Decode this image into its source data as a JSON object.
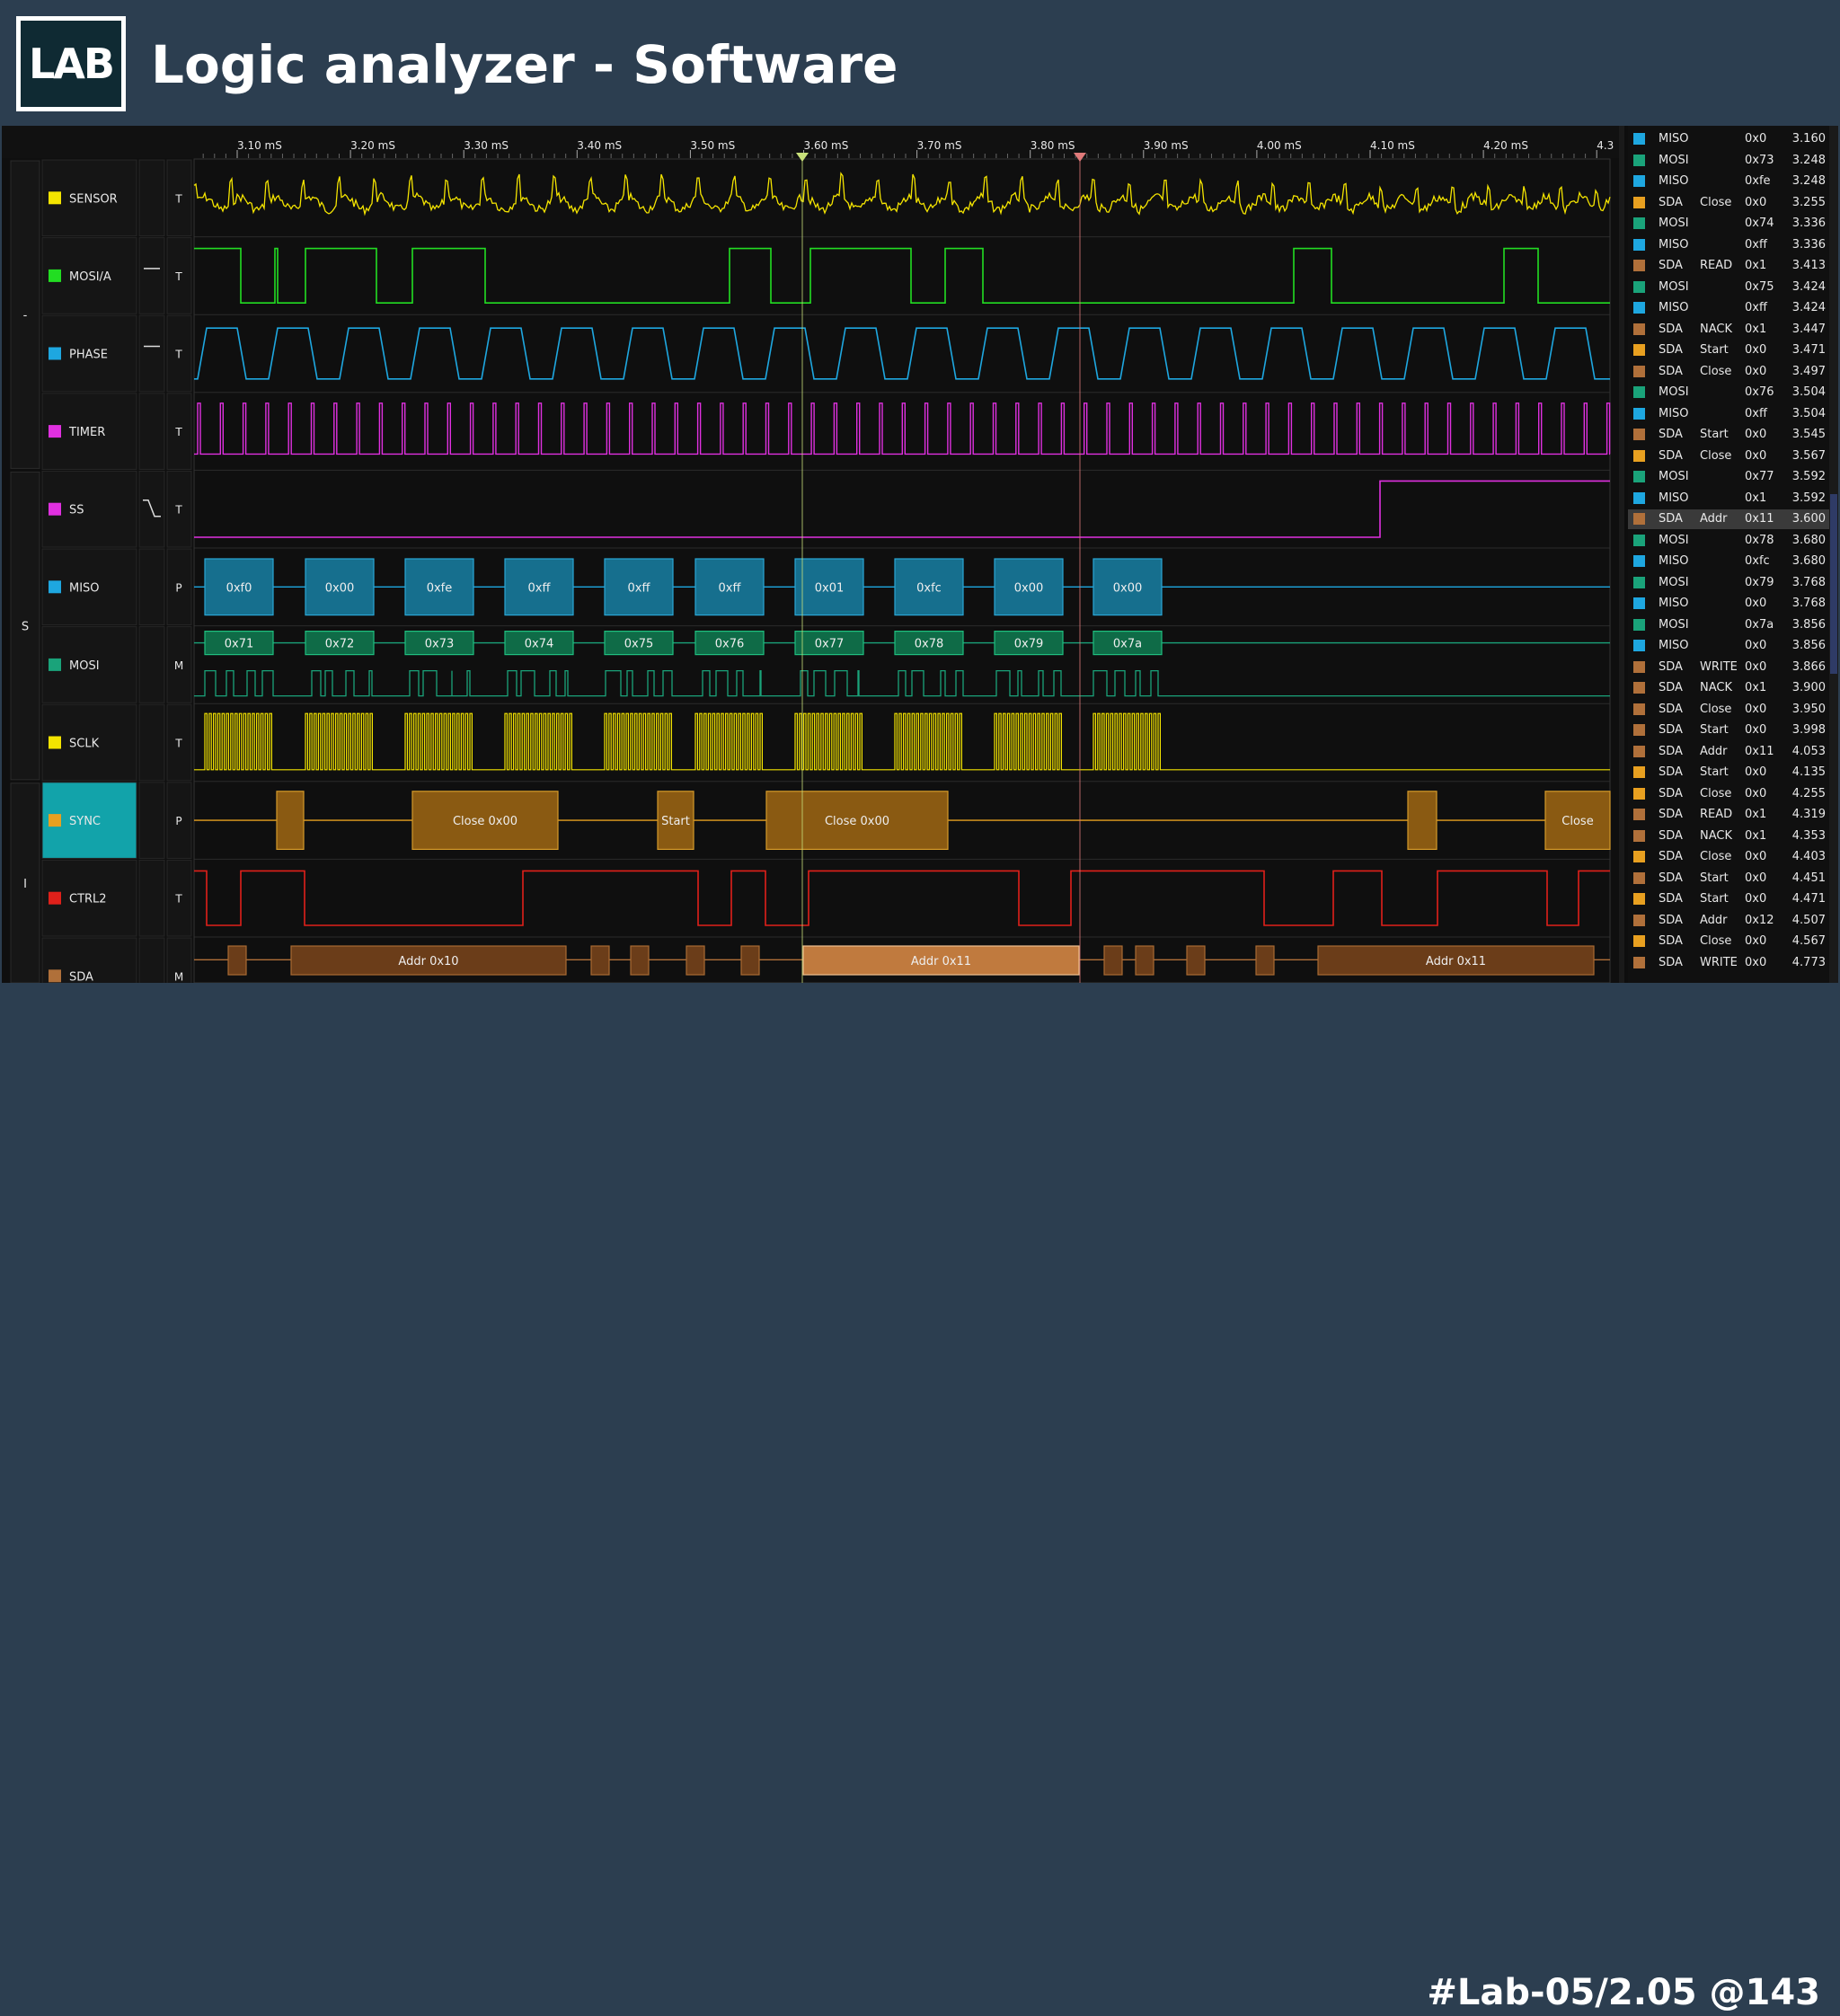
{
  "header": {
    "logo_text": "LAB",
    "title": "Logic analyzer - Software"
  },
  "footer": {
    "tag": "#Lab-05/2.05 @143"
  },
  "colors": {
    "yellow": "#f4e400",
    "green": "#22dd22",
    "cyan": "#1ea7e0",
    "magenta": "#e030e0",
    "teal": "#1aa37a",
    "orange": "#e8a020",
    "red": "#e0201a",
    "brown": "#b0703a"
  },
  "time_axis": {
    "labels": [
      "3.10 mS",
      "3.20 mS",
      "3.30 mS",
      "3.40 mS",
      "3.50 mS",
      "3.60 mS",
      "3.70 mS",
      "3.80 mS",
      "3.90 mS",
      "4.00 mS",
      "4.10 mS",
      "4.20 mS",
      "4.3"
    ]
  },
  "groups": [
    "-",
    "S",
    "I"
  ],
  "channels": [
    {
      "name": "SENSOR",
      "color": "yellow",
      "mode": "T",
      "edge": ""
    },
    {
      "name": "MOSI/A",
      "color": "green",
      "mode": "T",
      "edge": "high"
    },
    {
      "name": "PHASE",
      "color": "cyan",
      "mode": "T",
      "edge": "high"
    },
    {
      "name": "TIMER",
      "color": "magenta",
      "mode": "T",
      "edge": ""
    },
    {
      "name": "SS",
      "color": "magenta",
      "mode": "T",
      "edge": "fall"
    },
    {
      "name": "MISO",
      "color": "cyan",
      "mode": "P",
      "edge": ""
    },
    {
      "name": "MOSI",
      "color": "teal",
      "mode": "M",
      "edge": ""
    },
    {
      "name": "SCLK",
      "color": "yellow",
      "mode": "T",
      "edge": ""
    },
    {
      "name": "SYNC",
      "color": "orange",
      "mode": "P",
      "edge": ""
    },
    {
      "name": "CTRL2",
      "color": "red",
      "mode": "T",
      "edge": ""
    },
    {
      "name": "SDA",
      "color": "brown",
      "mode": "M",
      "edge": ""
    }
  ],
  "miso_bytes": [
    "0xf0",
    "0x00",
    "0xfe",
    "0xff",
    "0xff",
    "0xff",
    "0x01",
    "0xfc",
    "0x00",
    "0x00"
  ],
  "mosi_bytes": [
    "0x71",
    "0x72",
    "0x73",
    "0x74",
    "0x75",
    "0x76",
    "0x77",
    "0x78",
    "0x79",
    "0x7a"
  ],
  "sync_labels": [
    "Close 0x00",
    "Start",
    "Close 0x00",
    "Close"
  ],
  "sda_labels": [
    "Addr 0x10",
    "Addr 0x11",
    "Addr 0x11"
  ],
  "protocol_rows": [
    {
      "color": "cyan",
      "ch": "MISO",
      "ev": "",
      "val": "0x0",
      "t": "3.160"
    },
    {
      "color": "teal",
      "ch": "MOSI",
      "ev": "",
      "val": "0x73",
      "t": "3.248"
    },
    {
      "color": "cyan",
      "ch": "MISO",
      "ev": "",
      "val": "0xfe",
      "t": "3.248"
    },
    {
      "color": "orange",
      "ch": "SDA",
      "ev": "Close",
      "val": "0x0",
      "t": "3.255"
    },
    {
      "color": "teal",
      "ch": "MOSI",
      "ev": "",
      "val": "0x74",
      "t": "3.336"
    },
    {
      "color": "cyan",
      "ch": "MISO",
      "ev": "",
      "val": "0xff",
      "t": "3.336"
    },
    {
      "color": "brown",
      "ch": "SDA",
      "ev": "READ",
      "val": "0x1",
      "t": "3.413"
    },
    {
      "color": "teal",
      "ch": "MOSI",
      "ev": "",
      "val": "0x75",
      "t": "3.424"
    },
    {
      "color": "cyan",
      "ch": "MISO",
      "ev": "",
      "val": "0xff",
      "t": "3.424"
    },
    {
      "color": "brown",
      "ch": "SDA",
      "ev": "NACK",
      "val": "0x1",
      "t": "3.447"
    },
    {
      "color": "orange",
      "ch": "SDA",
      "ev": "Start",
      "val": "0x0",
      "t": "3.471"
    },
    {
      "color": "brown",
      "ch": "SDA",
      "ev": "Close",
      "val": "0x0",
      "t": "3.497"
    },
    {
      "color": "teal",
      "ch": "MOSI",
      "ev": "",
      "val": "0x76",
      "t": "3.504"
    },
    {
      "color": "cyan",
      "ch": "MISO",
      "ev": "",
      "val": "0xff",
      "t": "3.504"
    },
    {
      "color": "brown",
      "ch": "SDA",
      "ev": "Start",
      "val": "0x0",
      "t": "3.545"
    },
    {
      "color": "orange",
      "ch": "SDA",
      "ev": "Close",
      "val": "0x0",
      "t": "3.567"
    },
    {
      "color": "teal",
      "ch": "MOSI",
      "ev": "",
      "val": "0x77",
      "t": "3.592"
    },
    {
      "color": "cyan",
      "ch": "MISO",
      "ev": "",
      "val": "0x1",
      "t": "3.592"
    },
    {
      "color": "brown",
      "ch": "SDA",
      "ev": "Addr",
      "val": "0x11",
      "t": "3.600",
      "selected": true
    },
    {
      "color": "teal",
      "ch": "MOSI",
      "ev": "",
      "val": "0x78",
      "t": "3.680"
    },
    {
      "color": "cyan",
      "ch": "MISO",
      "ev": "",
      "val": "0xfc",
      "t": "3.680"
    },
    {
      "color": "teal",
      "ch": "MOSI",
      "ev": "",
      "val": "0x79",
      "t": "3.768"
    },
    {
      "color": "cyan",
      "ch": "MISO",
      "ev": "",
      "val": "0x0",
      "t": "3.768"
    },
    {
      "color": "teal",
      "ch": "MOSI",
      "ev": "",
      "val": "0x7a",
      "t": "3.856"
    },
    {
      "color": "cyan",
      "ch": "MISO",
      "ev": "",
      "val": "0x0",
      "t": "3.856"
    },
    {
      "color": "brown",
      "ch": "SDA",
      "ev": "WRITE",
      "val": "0x0",
      "t": "3.866"
    },
    {
      "color": "brown",
      "ch": "SDA",
      "ev": "NACK",
      "val": "0x1",
      "t": "3.900"
    },
    {
      "color": "brown",
      "ch": "SDA",
      "ev": "Close",
      "val": "0x0",
      "t": "3.950"
    },
    {
      "color": "brown",
      "ch": "SDA",
      "ev": "Start",
      "val": "0x0",
      "t": "3.998"
    },
    {
      "color": "brown",
      "ch": "SDA",
      "ev": "Addr",
      "val": "0x11",
      "t": "4.053"
    },
    {
      "color": "orange",
      "ch": "SDA",
      "ev": "Start",
      "val": "0x0",
      "t": "4.135"
    },
    {
      "color": "orange",
      "ch": "SDA",
      "ev": "Close",
      "val": "0x0",
      "t": "4.255"
    },
    {
      "color": "brown",
      "ch": "SDA",
      "ev": "READ",
      "val": "0x1",
      "t": "4.319"
    },
    {
      "color": "brown",
      "ch": "SDA",
      "ev": "NACK",
      "val": "0x1",
      "t": "4.353"
    },
    {
      "color": "orange",
      "ch": "SDA",
      "ev": "Close",
      "val": "0x0",
      "t": "4.403"
    },
    {
      "color": "brown",
      "ch": "SDA",
      "ev": "Start",
      "val": "0x0",
      "t": "4.451"
    },
    {
      "color": "orange",
      "ch": "SDA",
      "ev": "Start",
      "val": "0x0",
      "t": "4.471"
    },
    {
      "color": "brown",
      "ch": "SDA",
      "ev": "Addr",
      "val": "0x12",
      "t": "4.507"
    },
    {
      "color": "orange",
      "ch": "SDA",
      "ev": "Close",
      "val": "0x0",
      "t": "4.567"
    },
    {
      "color": "brown",
      "ch": "SDA",
      "ev": "WRITE",
      "val": "0x0",
      "t": "4.773"
    }
  ]
}
